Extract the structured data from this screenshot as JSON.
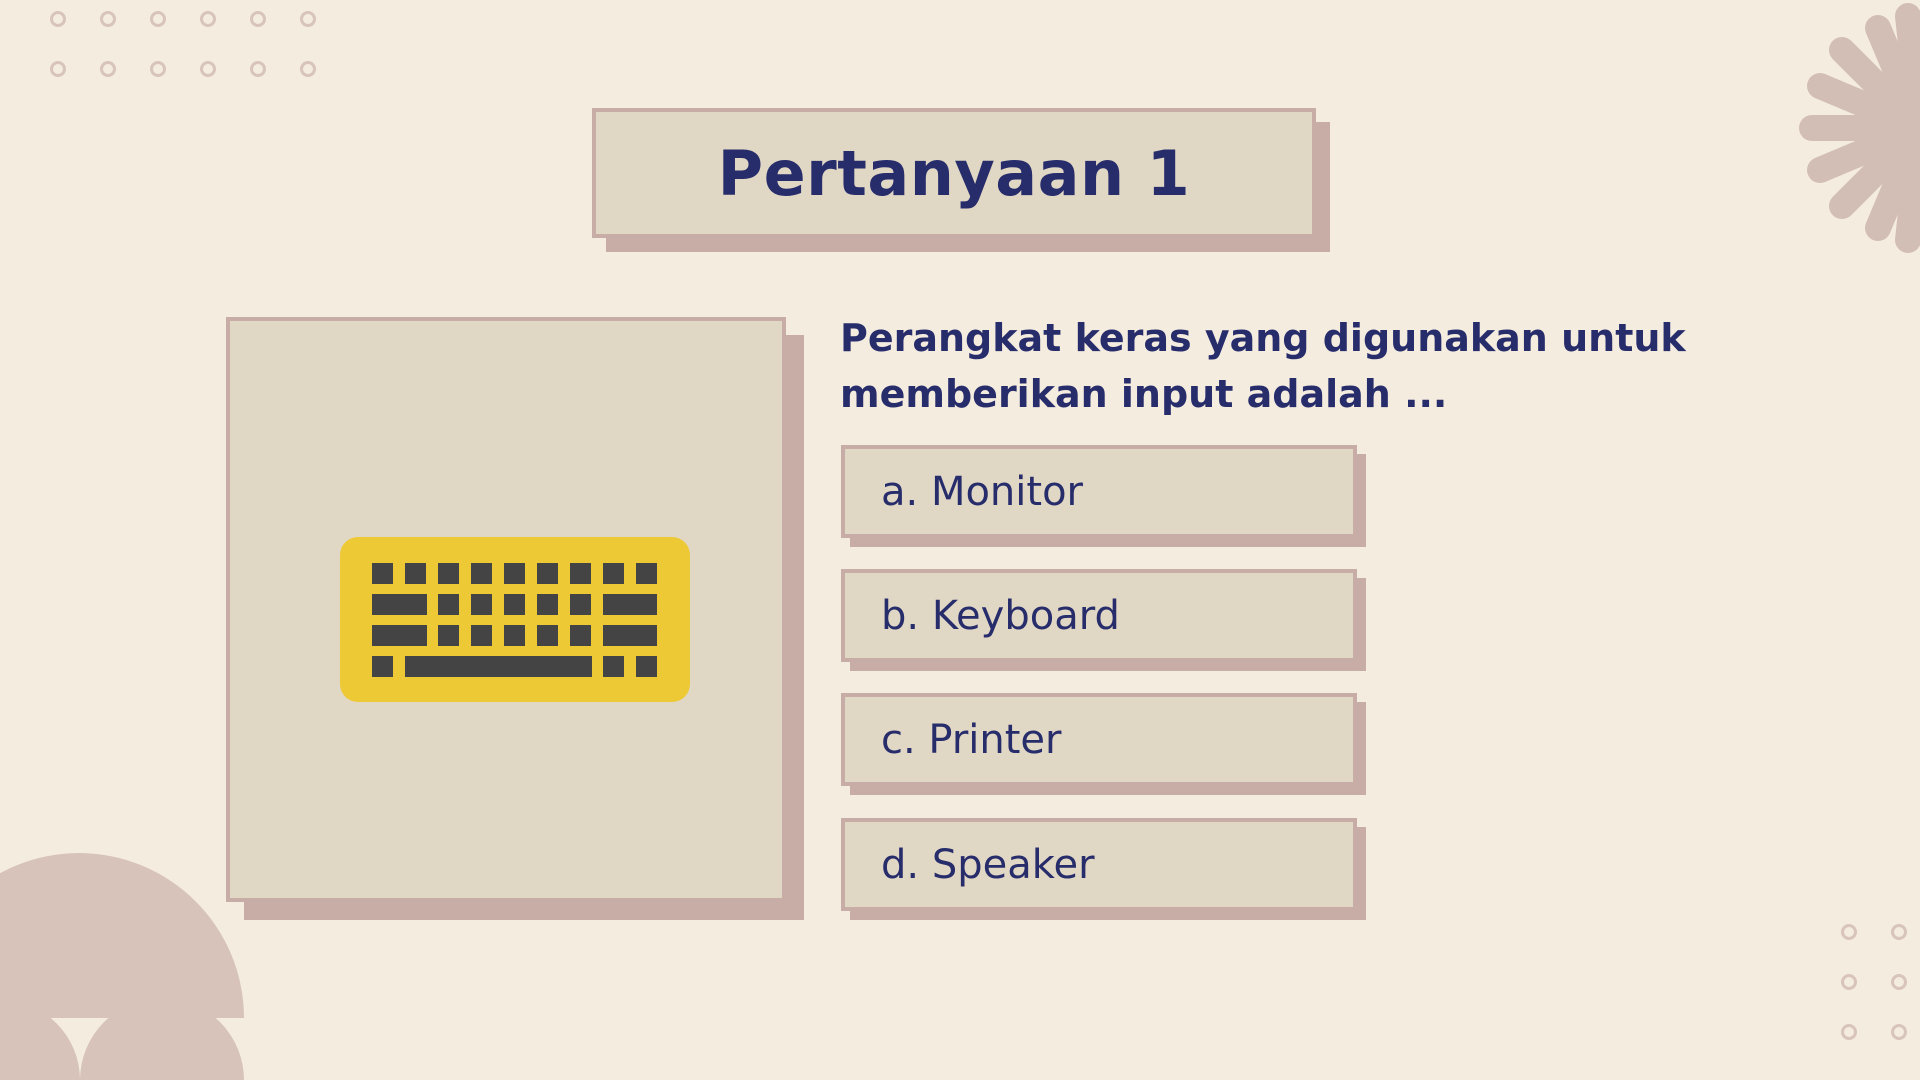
{
  "title": "Pertanyaan 1",
  "question": "Perangkat keras yang digunakan untuk memberikan input adalah ...",
  "image": {
    "icon": "keyboard-icon",
    "icon_color": "#EDC935",
    "key_color": "#444444"
  },
  "options": [
    {
      "label": "a. Monitor"
    },
    {
      "label": "b. Keyboard"
    },
    {
      "label": "c. Printer"
    },
    {
      "label": "d. Speaker"
    }
  ],
  "colors": {
    "background": "#F4ECDF",
    "card": "#E1D7C5",
    "card_edge": "#C8ADA6",
    "text": "#272C6B",
    "decoration": "#D8C4BB"
  }
}
